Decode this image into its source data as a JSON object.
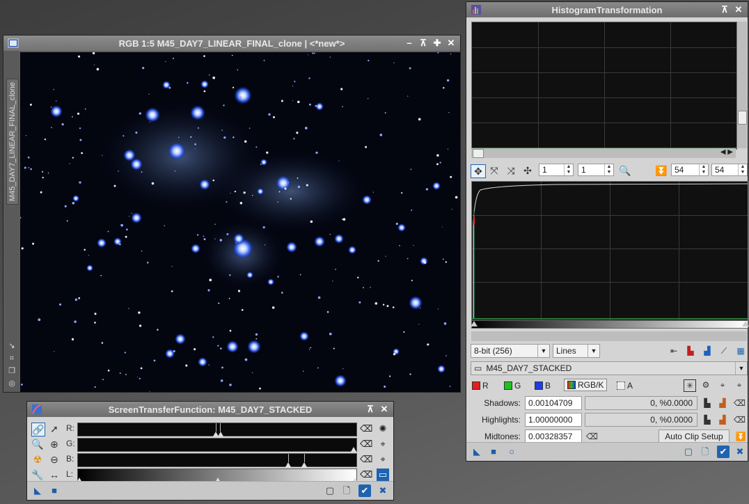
{
  "image_window": {
    "title": "RGB 1:5 M45_DAY7_LINEAR_FINAL_clone | <*new*>",
    "side_tab_label": "M45_DAY7_LINEAR_FINAL_clone"
  },
  "stf_window": {
    "title": "ScreenTransferFunction: M45_DAY7_STACKED",
    "channels": [
      {
        "label": "R:"
      },
      {
        "label": "G:"
      },
      {
        "label": "B:"
      },
      {
        "label": "L:"
      }
    ]
  },
  "histogram_window": {
    "title": "HistogramTransformation",
    "zoom_h": "1",
    "zoom_v": "1",
    "res_a": "54",
    "res_b": "54",
    "bit_depth": "8-bit (256)",
    "plot_mode": "Lines",
    "target_view": "M45_DAY7_STACKED",
    "channel_r": "R",
    "channel_g": "G",
    "channel_b": "B",
    "channel_rgbk": "RGB/K",
    "channel_a": "A",
    "shadows_label": "Shadows:",
    "shadows_value": "0.00104709",
    "shadows_clip": "0, %0.0000",
    "highlights_label": "Highlights:",
    "highlights_value": "1.00000000",
    "highlights_clip": "0, %0.0000",
    "midtones_label": "Midtones:",
    "midtones_value": "0.00328357",
    "auto_clip_label": "Auto Clip Setup"
  },
  "colors": {
    "accent": "#1f63b0",
    "red": "#e02020",
    "green": "#20c020",
    "blue": "#1c3fe0"
  }
}
